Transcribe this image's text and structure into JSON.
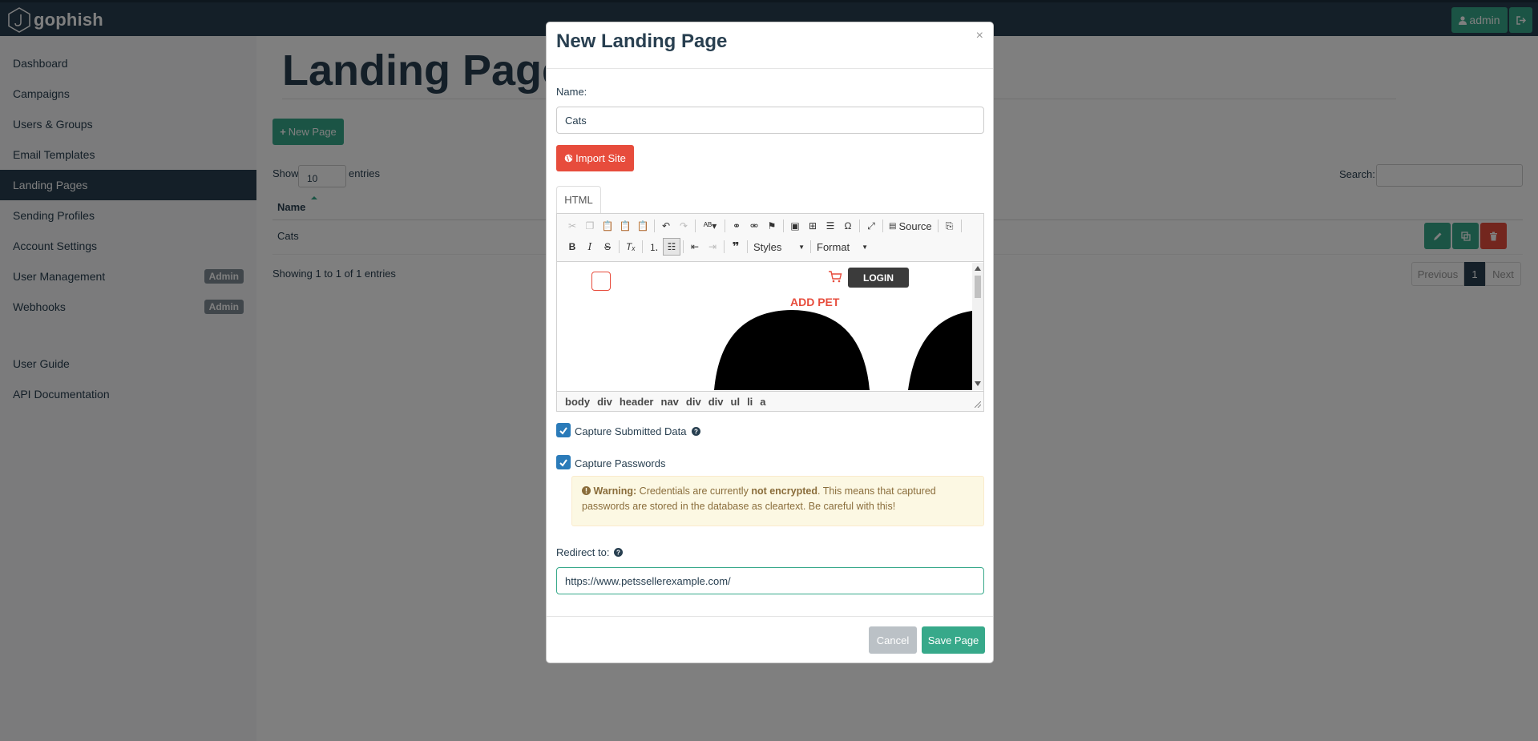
{
  "app": {
    "name": "gophish",
    "user": "admin"
  },
  "sidebar": {
    "items": [
      {
        "label": "Dashboard"
      },
      {
        "label": "Campaigns"
      },
      {
        "label": "Users & Groups"
      },
      {
        "label": "Email Templates"
      },
      {
        "label": "Landing Pages",
        "active": true
      },
      {
        "label": "Sending Profiles"
      },
      {
        "label": "Account Settings"
      },
      {
        "label": "User Management",
        "badge": "Admin"
      },
      {
        "label": "Webhooks",
        "badge": "Admin"
      },
      {
        "label": "User Guide"
      },
      {
        "label": "API Documentation"
      }
    ]
  },
  "main": {
    "title": "Landing Pages",
    "new_page_label": "New Page",
    "show_label": "Show",
    "entries_value": "10",
    "entries_label": "entries",
    "search_label": "Search:",
    "table": {
      "headers": [
        "Name"
      ],
      "rows": [
        {
          "name": "Cats"
        }
      ]
    },
    "info": "Showing 1 to 1 of 1 entries",
    "pagination": {
      "previous": "Previous",
      "page": "1",
      "next": "Next"
    }
  },
  "modal": {
    "title": "New Landing Page",
    "close": "×",
    "name_label": "Name:",
    "name_value": "Cats",
    "import_label": "Import Site",
    "tab_label": "HTML",
    "toolbar": {
      "source_label": "Source",
      "styles_label": "Styles",
      "format_label": "Format"
    },
    "preview": {
      "login_label": "LOGIN",
      "add_pet_label": "ADD PET"
    },
    "path": [
      "body",
      "div",
      "header",
      "nav",
      "div",
      "div",
      "ul",
      "li",
      "a"
    ],
    "capture_submitted_label": "Capture Submitted Data",
    "capture_submitted_checked": true,
    "capture_passwords_label": "Capture Passwords",
    "capture_passwords_checked": true,
    "warning": {
      "prefix": "Warning:",
      "text1": " Credentials are currently ",
      "bold": "not encrypted",
      "text2": ". This means that captured passwords are stored in the database as cleartext. Be careful with this!"
    },
    "redirect_label": "Redirect to:",
    "redirect_value": "https://www.petssellerexample.com/",
    "cancel_label": "Cancel",
    "save_label": "Save Page"
  },
  "colors": {
    "navbar": "#283f50",
    "accent_green": "#37a98a",
    "danger_red": "#e74c3c",
    "checkbox_blue": "#2b7bb9",
    "warning_bg": "#fcf8e3"
  },
  "icons": {
    "logo": "gophish-hexagon-logo",
    "user": "user-icon",
    "logout": "sign-out-icon",
    "plus": "plus-icon",
    "globe": "globe-icon",
    "help": "question-circle-icon",
    "warning": "exclamation-circle-icon",
    "edit": "pencil-icon",
    "copy": "copy-icon",
    "delete": "trash-icon",
    "cart": "shopping-cart-icon"
  }
}
